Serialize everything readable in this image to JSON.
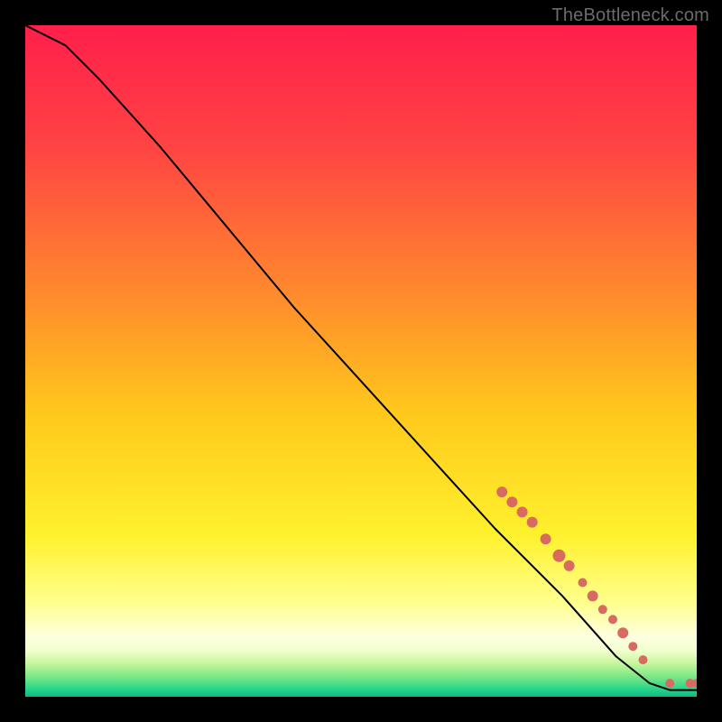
{
  "watermark": "TheBottleneck.com",
  "chart_data": {
    "type": "line",
    "title": "",
    "xlabel": "",
    "ylabel": "",
    "xlim": [
      0,
      100
    ],
    "ylim": [
      0,
      100
    ],
    "curve": [
      {
        "x": 0,
        "y": 100
      },
      {
        "x": 6,
        "y": 97
      },
      {
        "x": 11,
        "y": 92
      },
      {
        "x": 20,
        "y": 82
      },
      {
        "x": 30,
        "y": 70
      },
      {
        "x": 40,
        "y": 58
      },
      {
        "x": 50,
        "y": 47
      },
      {
        "x": 60,
        "y": 36
      },
      {
        "x": 70,
        "y": 25
      },
      {
        "x": 80,
        "y": 15
      },
      {
        "x": 88,
        "y": 6
      },
      {
        "x": 93,
        "y": 2
      },
      {
        "x": 96,
        "y": 1
      },
      {
        "x": 100,
        "y": 1
      }
    ],
    "markers": [
      {
        "x": 71,
        "y": 30.5,
        "r": 6
      },
      {
        "x": 72.5,
        "y": 29,
        "r": 6
      },
      {
        "x": 74,
        "y": 27.5,
        "r": 6
      },
      {
        "x": 75.5,
        "y": 26,
        "r": 6
      },
      {
        "x": 77.5,
        "y": 23.5,
        "r": 6
      },
      {
        "x": 79.5,
        "y": 21,
        "r": 7
      },
      {
        "x": 81,
        "y": 19.5,
        "r": 6
      },
      {
        "x": 83,
        "y": 17,
        "r": 5
      },
      {
        "x": 84.5,
        "y": 15,
        "r": 6
      },
      {
        "x": 86,
        "y": 13,
        "r": 5
      },
      {
        "x": 87.5,
        "y": 11.5,
        "r": 5
      },
      {
        "x": 89,
        "y": 9.5,
        "r": 6
      },
      {
        "x": 90.5,
        "y": 7.5,
        "r": 5
      },
      {
        "x": 92,
        "y": 5.5,
        "r": 5
      },
      {
        "x": 96,
        "y": 2,
        "r": 5
      },
      {
        "x": 99,
        "y": 2,
        "r": 5
      },
      {
        "x": 100,
        "y": 2,
        "r": 5
      }
    ],
    "marker_color": "#d86a62",
    "line_color": "#000000",
    "gradient_stops": [
      {
        "pct": 0,
        "color": "#ff1f4b"
      },
      {
        "pct": 18,
        "color": "#ff4343"
      },
      {
        "pct": 40,
        "color": "#ff8a2d"
      },
      {
        "pct": 58,
        "color": "#ffc91c"
      },
      {
        "pct": 76,
        "color": "#fff12d"
      },
      {
        "pct": 86,
        "color": "#ffff8d"
      },
      {
        "pct": 91,
        "color": "#ffffe0"
      },
      {
        "pct": 93,
        "color": "#f3ffd0"
      },
      {
        "pct": 95,
        "color": "#c7f79d"
      },
      {
        "pct": 97,
        "color": "#7be885"
      },
      {
        "pct": 99,
        "color": "#22d38a"
      },
      {
        "pct": 100,
        "color": "#0fb884"
      }
    ]
  }
}
